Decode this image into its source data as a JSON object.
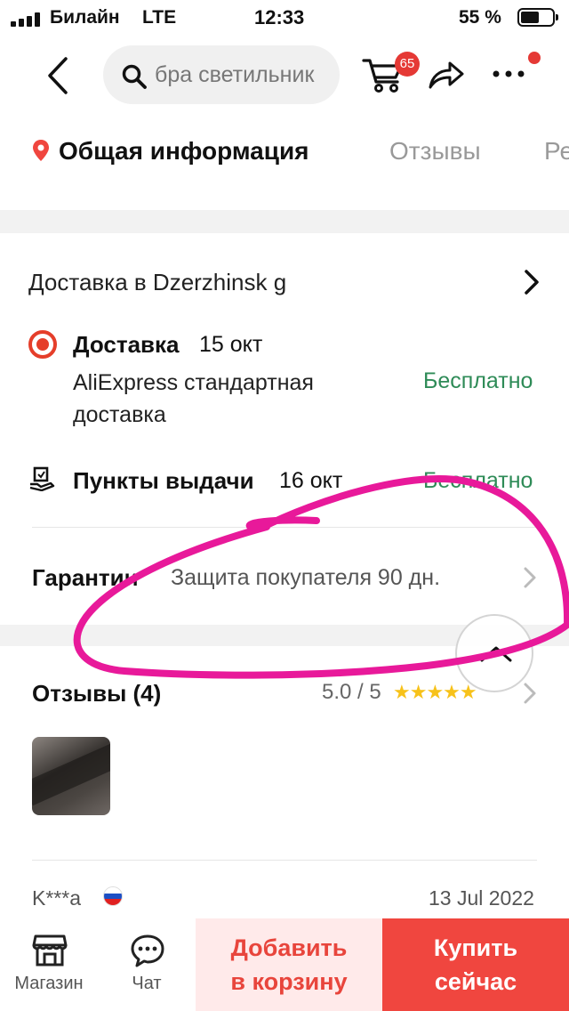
{
  "status_bar": {
    "carrier": "Билайн",
    "network": "LTE",
    "time": "12:33",
    "battery": "55 %",
    "battery_level": 0.55
  },
  "header": {
    "back_icon": "chevron-left-icon",
    "search": {
      "value": "бра светильник",
      "icon": "search-icon"
    },
    "cart_badge": "65",
    "share_icon": "share-arrow-icon",
    "more_icon": "more-dots-icon"
  },
  "tabs": [
    {
      "label": "Общая информация",
      "icon": "location-pin-icon",
      "active": true
    },
    {
      "label": "Отзывы",
      "active": false
    },
    {
      "label": "Ре",
      "active": false
    }
  ],
  "delivery": {
    "destination": "Доставка в Dzerzhinsk g",
    "courier": {
      "title": "Доставка",
      "date": "15 окт",
      "description": "AliExpress стандартная доставка",
      "price": "Бесплатно"
    },
    "pickup": {
      "title": "Пункты выдачи",
      "date": "16 окт",
      "price": "Бесплатно"
    }
  },
  "guarantee": {
    "label": "Гарантии",
    "value": "Защита покупателя 90 дн."
  },
  "reviews": {
    "label": "Отзывы (4)",
    "score": "5.0 / 5",
    "stars": "★★★★★",
    "rating": 5,
    "item": {
      "user": "K***a",
      "date": "13 Jul 2022",
      "flag": "russia-flag-icon"
    }
  },
  "bottom_bar": {
    "store": {
      "label": "Магазин",
      "icon": "store-icon"
    },
    "chat": {
      "label": "Чат",
      "icon": "chat-bubble-icon"
    },
    "add_to_cart": [
      "Добавить",
      "в корзину"
    ],
    "buy_now": [
      "Купить",
      "сейчас"
    ]
  },
  "colors": {
    "accent_red": "#f0463f",
    "free_green": "#2e8b57",
    "annotation_magenta": "#e8199a",
    "star_yellow": "#f7c21a"
  }
}
